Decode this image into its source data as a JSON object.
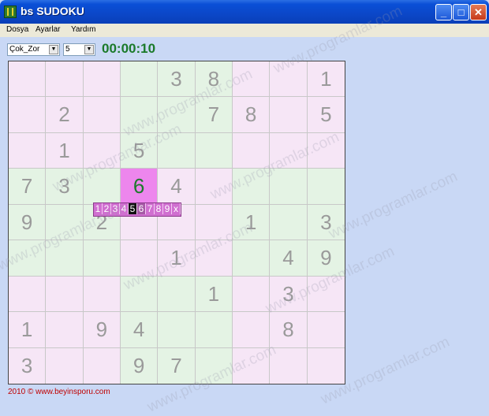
{
  "window": {
    "title": "bs SUDOKU",
    "min_glyph": "_",
    "max_glyph": "□",
    "close_glyph": "✕"
  },
  "menu": [
    "Dosya",
    "Ayarlar",
    "Yardım"
  ],
  "toolbar": {
    "level": "Çok_Zor",
    "number": "5",
    "timer": "00:00:10"
  },
  "board": {
    "selected": {
      "row": 3,
      "col": 3
    },
    "rows": [
      [
        "",
        "",
        "",
        "",
        "3",
        "8",
        "",
        "",
        "1"
      ],
      [
        "",
        "2",
        "",
        "",
        "",
        "7",
        "8",
        "",
        "5"
      ],
      [
        "",
        "1",
        "",
        "5",
        "",
        "",
        "",
        "",
        ""
      ],
      [
        "7",
        "3",
        "",
        "6",
        "4",
        "",
        "",
        "",
        ""
      ],
      [
        "9",
        "",
        "2",
        "",
        "",
        "",
        "1",
        "",
        "3"
      ],
      [
        "",
        "",
        "",
        "",
        "1",
        "",
        "",
        "4",
        "9"
      ],
      [
        "",
        "",
        "",
        "",
        "",
        "1",
        "",
        "3",
        ""
      ],
      [
        "1",
        "",
        "9",
        "4",
        "",
        "",
        "",
        "8",
        ""
      ],
      [
        "3",
        "",
        "",
        "9",
        "7",
        "",
        "",
        "",
        ""
      ]
    ]
  },
  "picker": {
    "options": [
      "1",
      "2",
      "3",
      "4",
      "5",
      "6",
      "7",
      "8",
      "9",
      "x"
    ],
    "current": "5"
  },
  "footer": "2010 © www.beyinsporu.com",
  "watermark": "www.programlar.com"
}
